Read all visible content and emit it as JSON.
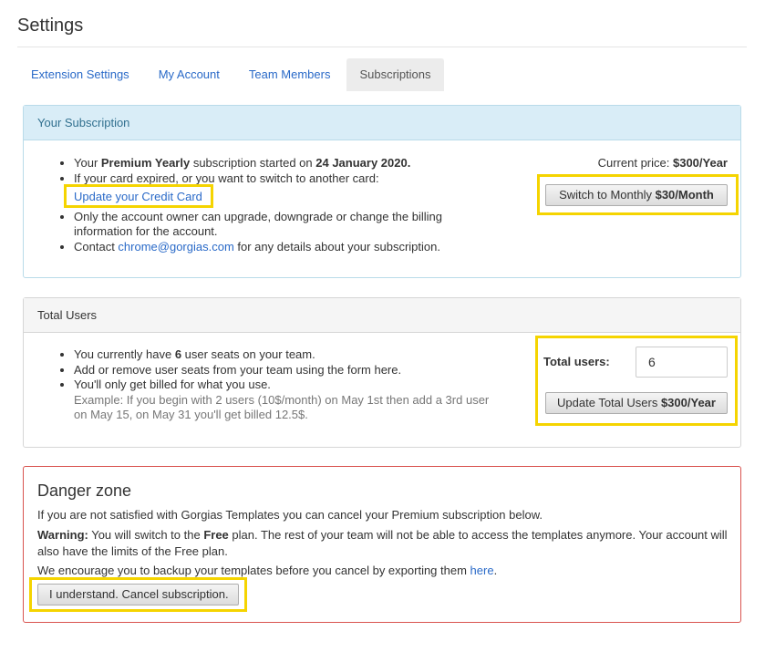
{
  "page": {
    "title": "Settings"
  },
  "tabs": [
    {
      "label": "Extension Settings"
    },
    {
      "label": "My Account"
    },
    {
      "label": "Team Members"
    },
    {
      "label": "Subscriptions",
      "active": true
    }
  ],
  "subscription": {
    "heading": "Your Subscription",
    "line1_pre": "Your ",
    "line1_plan": "Premium Yearly",
    "line1_mid": " subscription started on ",
    "line1_date": "24 January 2020.",
    "line2": "If your card expired, or you want to switch to another card:",
    "update_card_link": "Update your Credit Card",
    "line3": "Only the account owner can upgrade, downgrade or change the billing information for the account.",
    "line4_pre": "Contact ",
    "line4_email": "chrome@gorgias.com",
    "line4_post": " for any details about your subscription.",
    "price_label": "Current price: ",
    "price_value": "$300/Year",
    "switch_btn_pre": "Switch to Monthly ",
    "switch_btn_price": "$30/Month"
  },
  "users": {
    "heading": "Total Users",
    "line1_pre": "You currently have ",
    "line1_count": "6",
    "line1_post": " user seats on your team.",
    "line2": "Add or remove user seats from your team using the form here.",
    "line3": "You'll only get billed for what you use.",
    "example": "Example: If you begin with 2 users (10$/month) on May 1st then add a 3rd user on May 15, on May 31 you'll get billed 12.5$.",
    "total_label": "Total users:",
    "total_value": "6",
    "update_btn_pre": "Update Total Users ",
    "update_btn_price": "$300/Year"
  },
  "danger": {
    "title": "Danger zone",
    "p1": "If you are not satisfied with Gorgias Templates you can cancel your Premium subscription below.",
    "warning_label": "Warning:",
    "p2_a": " You will switch to the ",
    "p2_plan": "Free",
    "p2_b": " plan. The rest of your team will not be able to access the templates anymore. Your account will also have the limits of the Free plan.",
    "p3_pre": "We encourage you to backup your templates before you cancel by exporting them ",
    "p3_link": "here",
    "p3_post": ".",
    "cancel_btn": "I understand. Cancel subscription."
  },
  "colors": {
    "highlight": "#f5d400",
    "link": "#2a6ac8",
    "info_bg": "#d9edf7",
    "danger_border": "#d9534f"
  }
}
